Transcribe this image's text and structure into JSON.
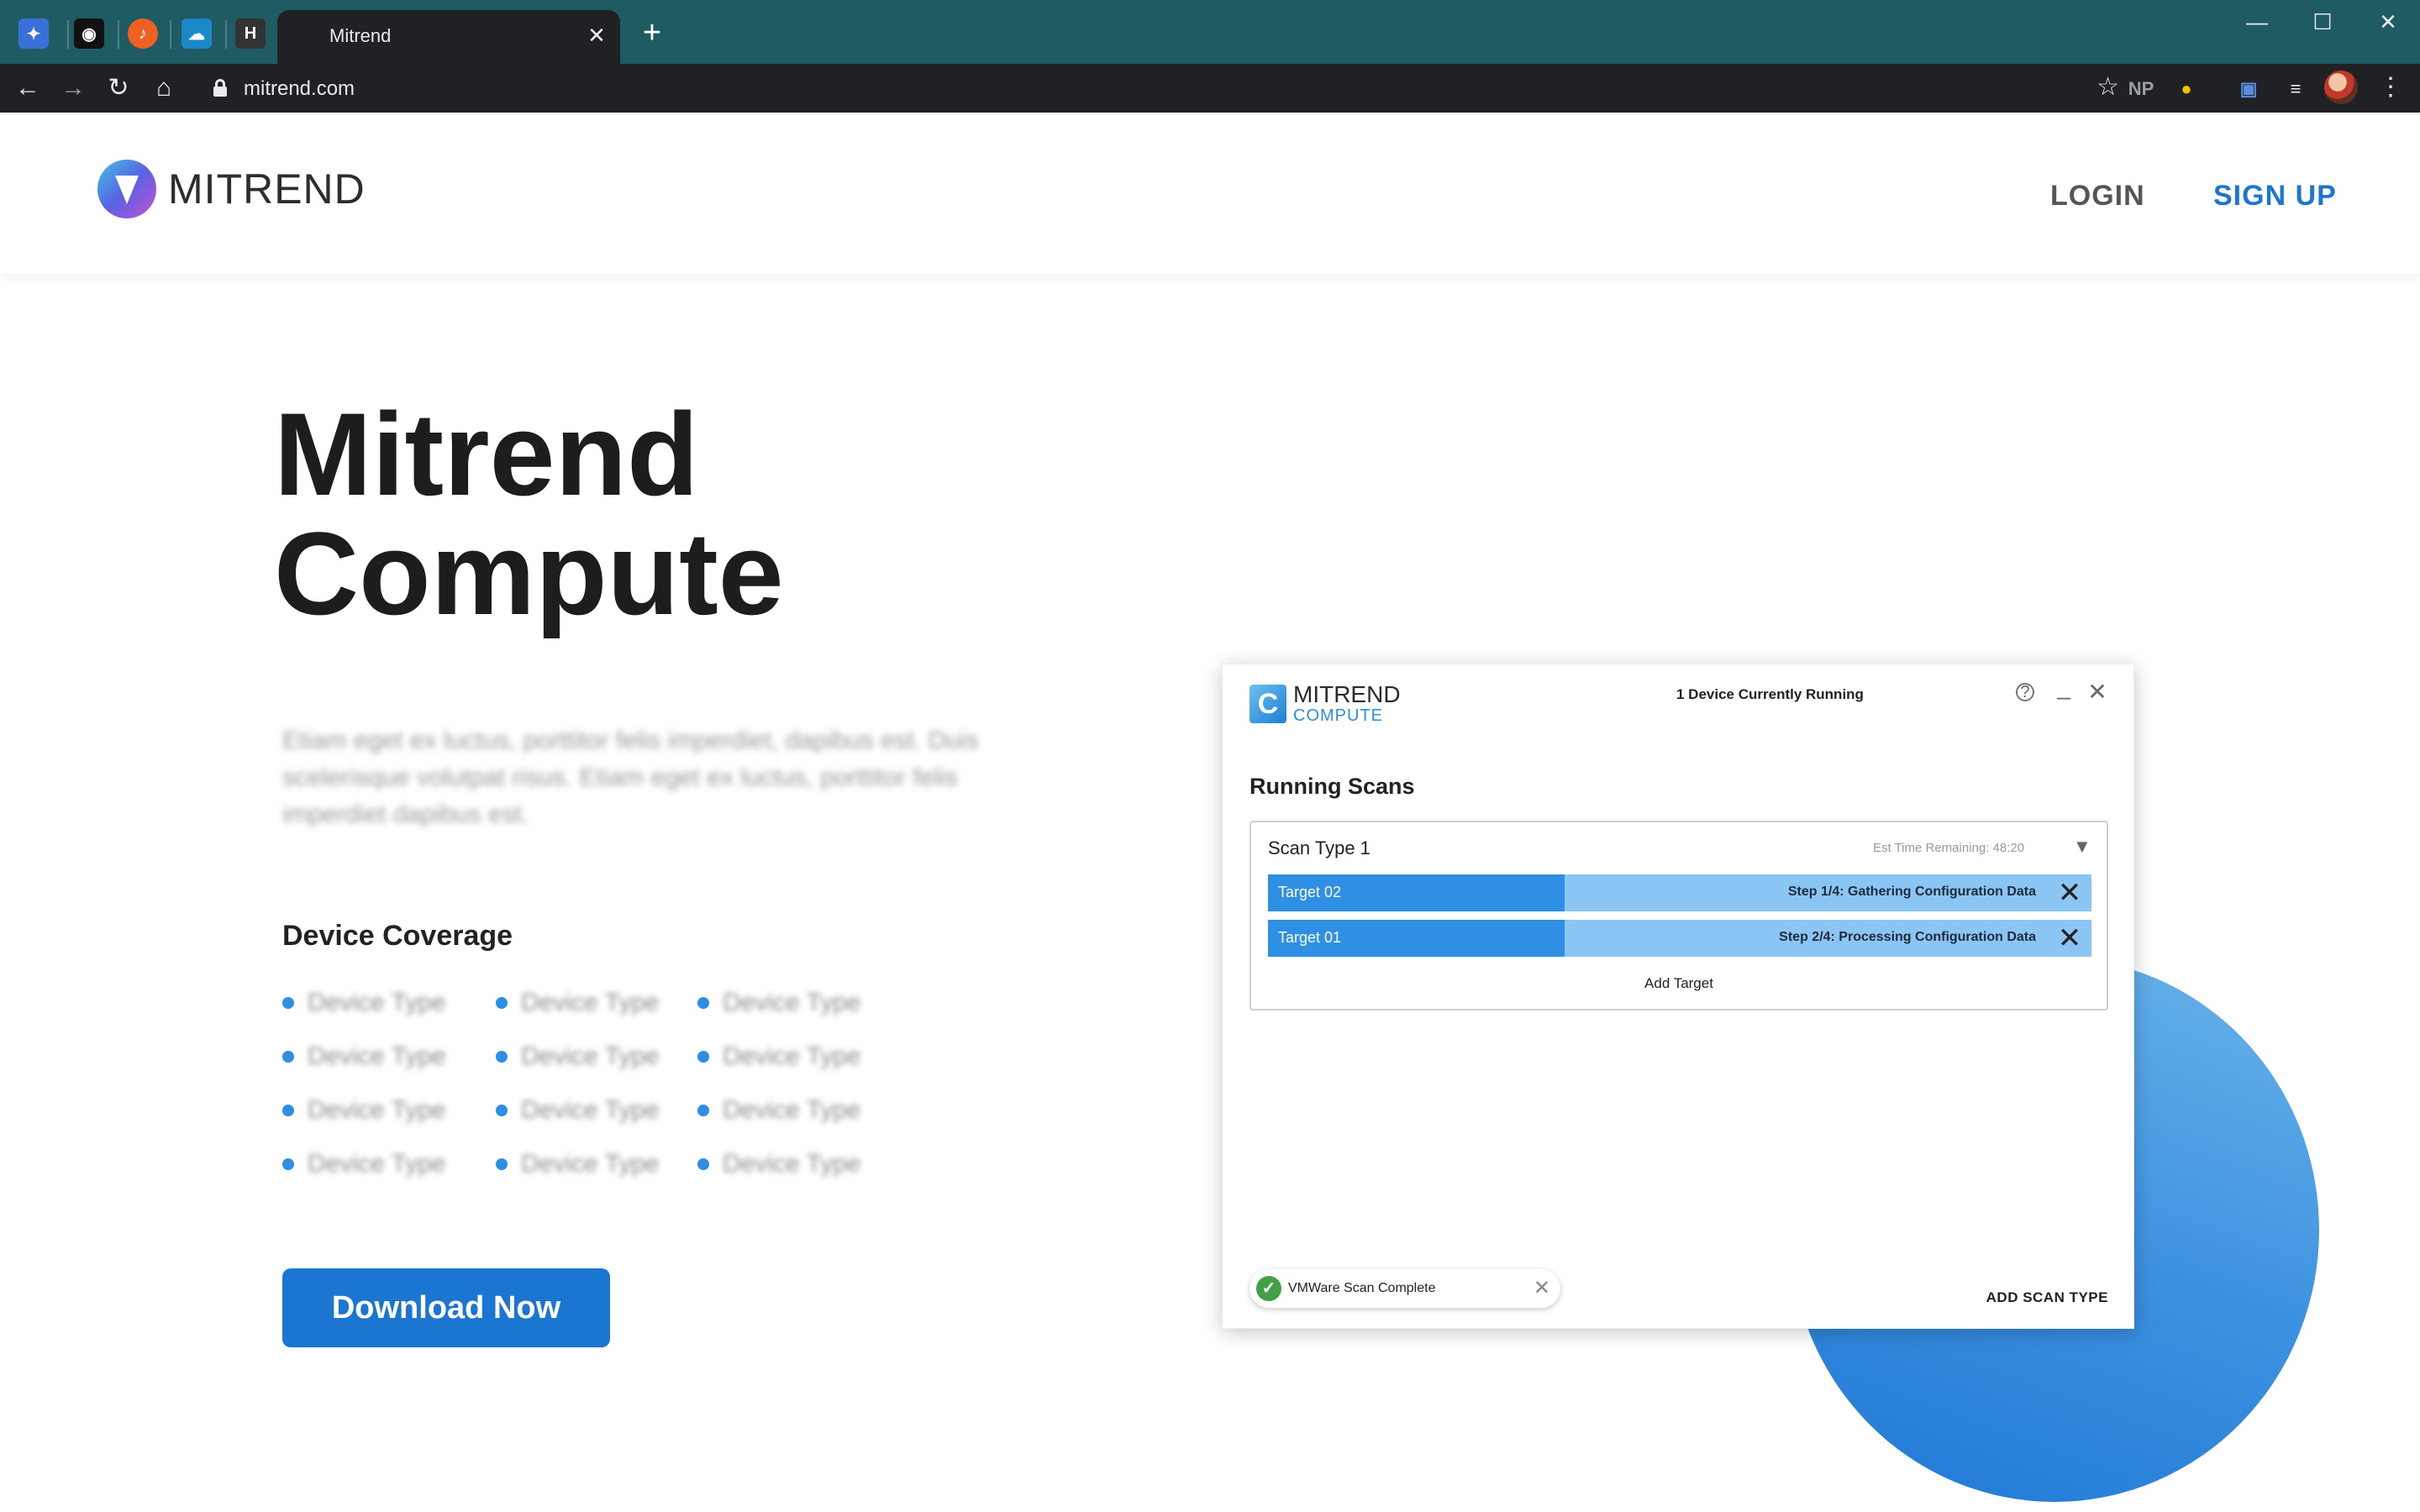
{
  "browser": {
    "pinned_tabs": [
      {
        "icon": "pinned-app-icon",
        "glyph": "✦",
        "color": "#3a6fd8"
      },
      {
        "icon": "github-icon",
        "glyph": "◉",
        "color": "#111111"
      },
      {
        "icon": "music-app-icon",
        "glyph": "♪",
        "color": "#f06022"
      },
      {
        "icon": "cloud-app-icon",
        "glyph": "☁",
        "color": "#1a88c9"
      },
      {
        "icon": "h-app-icon",
        "glyph": "H",
        "color": "#333333"
      }
    ],
    "active_tab_title": "Mitrend",
    "tab_close_glyph": "✕",
    "new_tab_glyph": "+",
    "window_controls": {
      "minimize": "—",
      "maximize": "☐",
      "close": "✕"
    },
    "nav": {
      "back": "←",
      "forward": "→",
      "reload": "↻",
      "home": "⌂"
    },
    "url": "mitrend.com",
    "bookmark_glyph": "☆",
    "extensions": [
      "NP",
      "●",
      "▣",
      "≡"
    ],
    "menu_glyph": "⋮"
  },
  "site": {
    "brand": "MITREND",
    "nav": {
      "login": "LOGIN",
      "signup": "SIGN UP"
    }
  },
  "hero": {
    "title_line1": "Mitrend",
    "title_line2": "Compute",
    "description": "Etiam eget ex luctus, porttitor felis imperdiet, dapibus est. Duis scelerisque volutpat risus. Etiam eget ex luctus, porttitor felis imperdiet dapibus est.",
    "coverage_title": "Device Coverage",
    "coverage_items": [
      "Device Type",
      "Device Type",
      "Device Type",
      "Device Type",
      "Device Type",
      "Device Type",
      "Device Type",
      "Device Type",
      "Device Type",
      "Device Type",
      "Device Type",
      "Device Type"
    ],
    "download_label": "Download Now"
  },
  "app": {
    "logo_letter": "C",
    "logo_top": "MITREND",
    "logo_bottom": "COMPUTE",
    "status": "1 Device Currently Running",
    "controls": {
      "help": "?",
      "minimize": "_",
      "close": "✕"
    },
    "heading": "Running Scans",
    "scan": {
      "type": "Scan Type 1",
      "est_time": "Est Time Remaining: 48:20",
      "caret": "▼",
      "targets": [
        {
          "name": "Target 02",
          "step": "Step 1/4: Gathering Configuration Data",
          "progress": 0.36
        },
        {
          "name": "Target 01",
          "step": "Step 2/4: Processing Configuration Data",
          "progress": 0.36
        }
      ],
      "add_target": "Add Target"
    },
    "toast": {
      "text": "VMWare Scan Complete",
      "check": "✓",
      "close": "✕"
    },
    "add_scan_type": "ADD SCAN TYPE"
  }
}
